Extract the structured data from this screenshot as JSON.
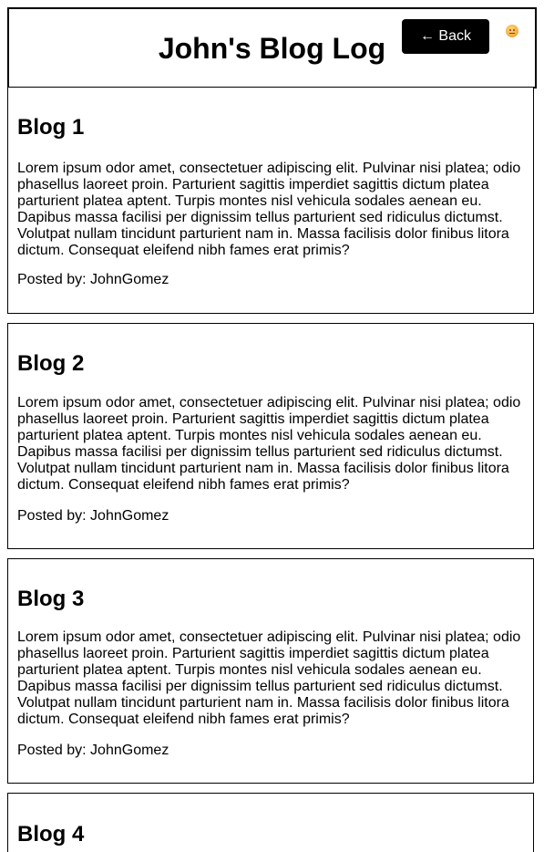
{
  "header": {
    "title": "John's Blog Log",
    "back_label": "← Back"
  },
  "posts": [
    {
      "title": "Blog 1",
      "body": "Lorem ipsum odor amet, consectetuer adipiscing elit. Pulvinar nisi platea; odio phasellus laoreet proin. Parturient sagittis imperdiet sagittis dictum platea parturient platea aptent. Turpis montes nisl vehicula sodales aenean eu. Dapibus massa facilisi per dignissim tellus parturient sed ridiculus dictumst. Volutpat nullam tincidunt parturient nam in. Massa facilisis dolor finibus litora dictum. Consequat eleifend nibh fames erat primis?",
      "author": "Posted by: JohnGomez"
    },
    {
      "title": "Blog 2",
      "body": "Lorem ipsum odor amet, consectetuer adipiscing elit. Pulvinar nisi platea; odio phasellus laoreet proin. Parturient sagittis imperdiet sagittis dictum platea parturient platea aptent. Turpis montes nisl vehicula sodales aenean eu. Dapibus massa facilisi per dignissim tellus parturient sed ridiculus dictumst. Volutpat nullam tincidunt parturient nam in. Massa facilisis dolor finibus litora dictum. Consequat eleifend nibh fames erat primis?",
      "author": "Posted by: JohnGomez"
    },
    {
      "title": "Blog 3",
      "body": "Lorem ipsum odor amet, consectetuer adipiscing elit. Pulvinar nisi platea; odio phasellus laoreet proin. Parturient sagittis imperdiet sagittis dictum platea parturient platea aptent. Turpis montes nisl vehicula sodales aenean eu. Dapibus massa facilisi per dignissim tellus parturient sed ridiculus dictumst. Volutpat nullam tincidunt parturient nam in. Massa facilisis dolor finibus litora dictum. Consequat eleifend nibh fames erat primis?",
      "author": "Posted by: JohnGomez"
    },
    {
      "title": "Blog 4"
    }
  ],
  "icons": {
    "avatar": "emoji-face-icon"
  }
}
